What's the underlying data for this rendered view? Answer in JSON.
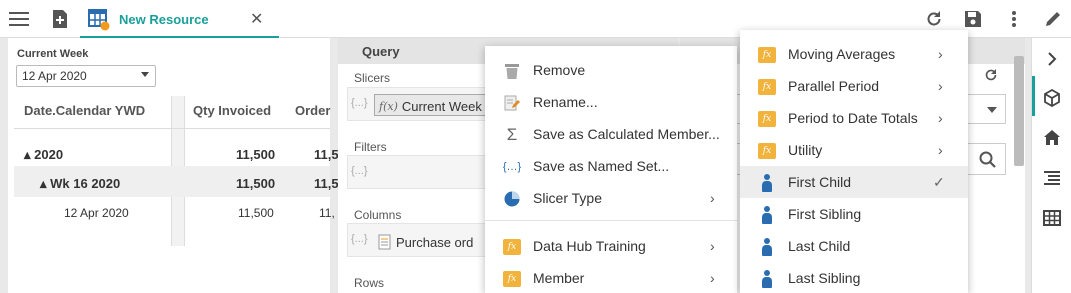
{
  "topbar": {
    "tab_title": "New Resource",
    "tab_close": "✕",
    "icons": [
      "menu-icon",
      "new-document-icon",
      "grid-resource-icon",
      "refresh-icon",
      "save-icon",
      "more-vertical-icon",
      "pencil-icon"
    ]
  },
  "rail": {
    "icons": [
      "chevron-right-icon",
      "cube-icon",
      "home-icon",
      "list-icon",
      "table-icon"
    ],
    "accent": "#1aa09a"
  },
  "left_panel": {
    "current_week_label": "Current Week",
    "current_week_value": "12 Apr 2020",
    "grid": {
      "headers": [
        "Date.Calendar YWD",
        "Qty Invoiced",
        "Order"
      ],
      "rows": [
        {
          "label": "▴ 2020",
          "qty": "11,500",
          "order": "11,5"
        },
        {
          "label": "▴ Wk 16 2020",
          "qty": "11,500",
          "order": "11,5"
        },
        {
          "label": "12 Apr 2020",
          "qty": "11,500",
          "order": "11,"
        }
      ]
    }
  },
  "query": {
    "title": "Query",
    "slicers_label": "Slicers",
    "slicer_chip": "Current Week",
    "filters_label": "Filters",
    "columns_label": "Columns",
    "columns_chip": "Purchase ord",
    "rows_label": "Rows",
    "brace": "{...}"
  },
  "context_menu": {
    "items": [
      {
        "label": "Remove",
        "icon": "trash-icon"
      },
      {
        "label": "Rename...",
        "icon": "rename-icon"
      },
      {
        "label": "Save as Calculated Member...",
        "icon": "sigma-icon"
      },
      {
        "label": "Save as Named Set...",
        "icon": "named-set-icon"
      },
      {
        "label": "Slicer Type",
        "icon": "pie-icon",
        "submenu": true
      },
      {
        "label": "Data Hub Training",
        "icon": "function-icon",
        "submenu": true
      },
      {
        "label": "Member",
        "icon": "function-icon",
        "submenu": true
      }
    ]
  },
  "submenu": {
    "items": [
      {
        "label": "Moving Averages",
        "icon": "function-icon",
        "submenu": true
      },
      {
        "label": "Parallel Period",
        "icon": "function-icon",
        "submenu": true
      },
      {
        "label": "Period to Date Totals",
        "icon": "function-icon",
        "submenu": true
      },
      {
        "label": "Utility",
        "icon": "function-icon",
        "submenu": true
      },
      {
        "label": "First Child",
        "icon": "member-icon",
        "checked": true
      },
      {
        "label": "First Sibling",
        "icon": "member-icon"
      },
      {
        "label": "Last Child",
        "icon": "member-icon"
      },
      {
        "label": "Last Sibling",
        "icon": "member-icon"
      }
    ],
    "check": "✓"
  },
  "colors": {
    "accent": "#1aa09a",
    "fx": "#f2b33d",
    "member": "#2a6cb0"
  }
}
